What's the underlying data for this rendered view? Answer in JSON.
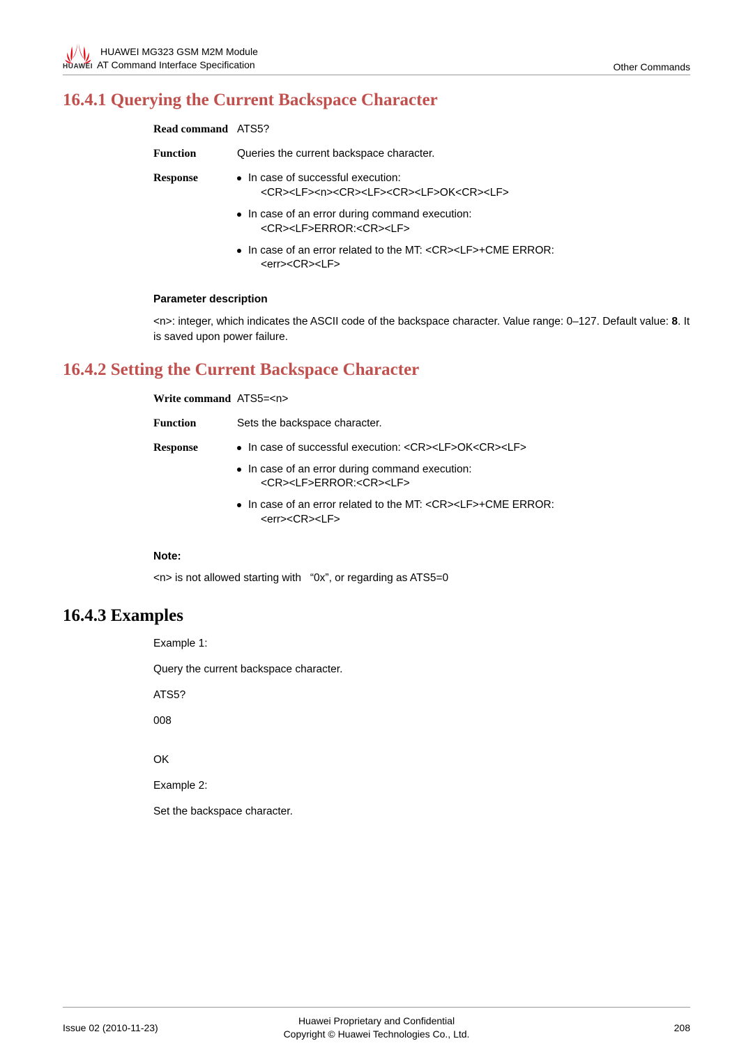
{
  "header": {
    "line1": "HUAWEI MG323 GSM M2M Module",
    "line2": "AT Command Interface Specification",
    "right": "Other Commands",
    "brand": "HUAWEI"
  },
  "s1": {
    "title": "16.4.1 Querying the Current Backspace Character",
    "read_label": "Read command",
    "read_val": "ATS5?",
    "func_label": "Function",
    "func_val": "Queries the current backspace character.",
    "resp_label": "Response",
    "r1a": "In case of successful execution:",
    "r1b": "<CR><LF><n><CR><LF><CR><LF>OK<CR><LF>",
    "r2a": "In case of an error during command execution:",
    "r2b": "<CR><LF>ERROR:<CR><LF>",
    "r3a": "In case of an error related to the MT: <CR><LF>+CME ERROR:",
    "r3b": "<err><CR><LF>",
    "param_title": "Parameter description",
    "param_text_a": "<n>: integer, which indicates the ASCII code of the backspace character. Value range: 0–127. Default value: ",
    "param_text_bold": "8",
    "param_text_b": ". It is saved upon power failure."
  },
  "s2": {
    "title": "16.4.2 Setting the Current Backspace Character",
    "write_label": "Write command",
    "write_val": "ATS5=<n>",
    "func_label": "Function",
    "func_val": "Sets the backspace character.",
    "resp_label": "Response",
    "r1": "In case of successful execution: <CR><LF>OK<CR><LF>",
    "r2a": "In case of an error during command execution:",
    "r2b": "<CR><LF>ERROR:<CR><LF>",
    "r3a": "In case of an error related to the MT: <CR><LF>+CME ERROR:",
    "r3b": "<err><CR><LF>",
    "note_label": "Note:",
    "note_text": "<n> is not allowed starting with   “0x”, or regarding as ATS5=0"
  },
  "s3": {
    "title": "16.4.3 Examples",
    "l1": "Example 1:",
    "l2": "Query the current backspace character.",
    "l3": "ATS5?",
    "l4": "008",
    "l5": "OK",
    "l6": "Example 2:",
    "l7": "Set the backspace character."
  },
  "footer": {
    "left": "Issue 02 (2010-11-23)",
    "center1": "Huawei Proprietary and Confidential",
    "center2": "Copyright © Huawei Technologies Co., Ltd.",
    "right": "208"
  }
}
